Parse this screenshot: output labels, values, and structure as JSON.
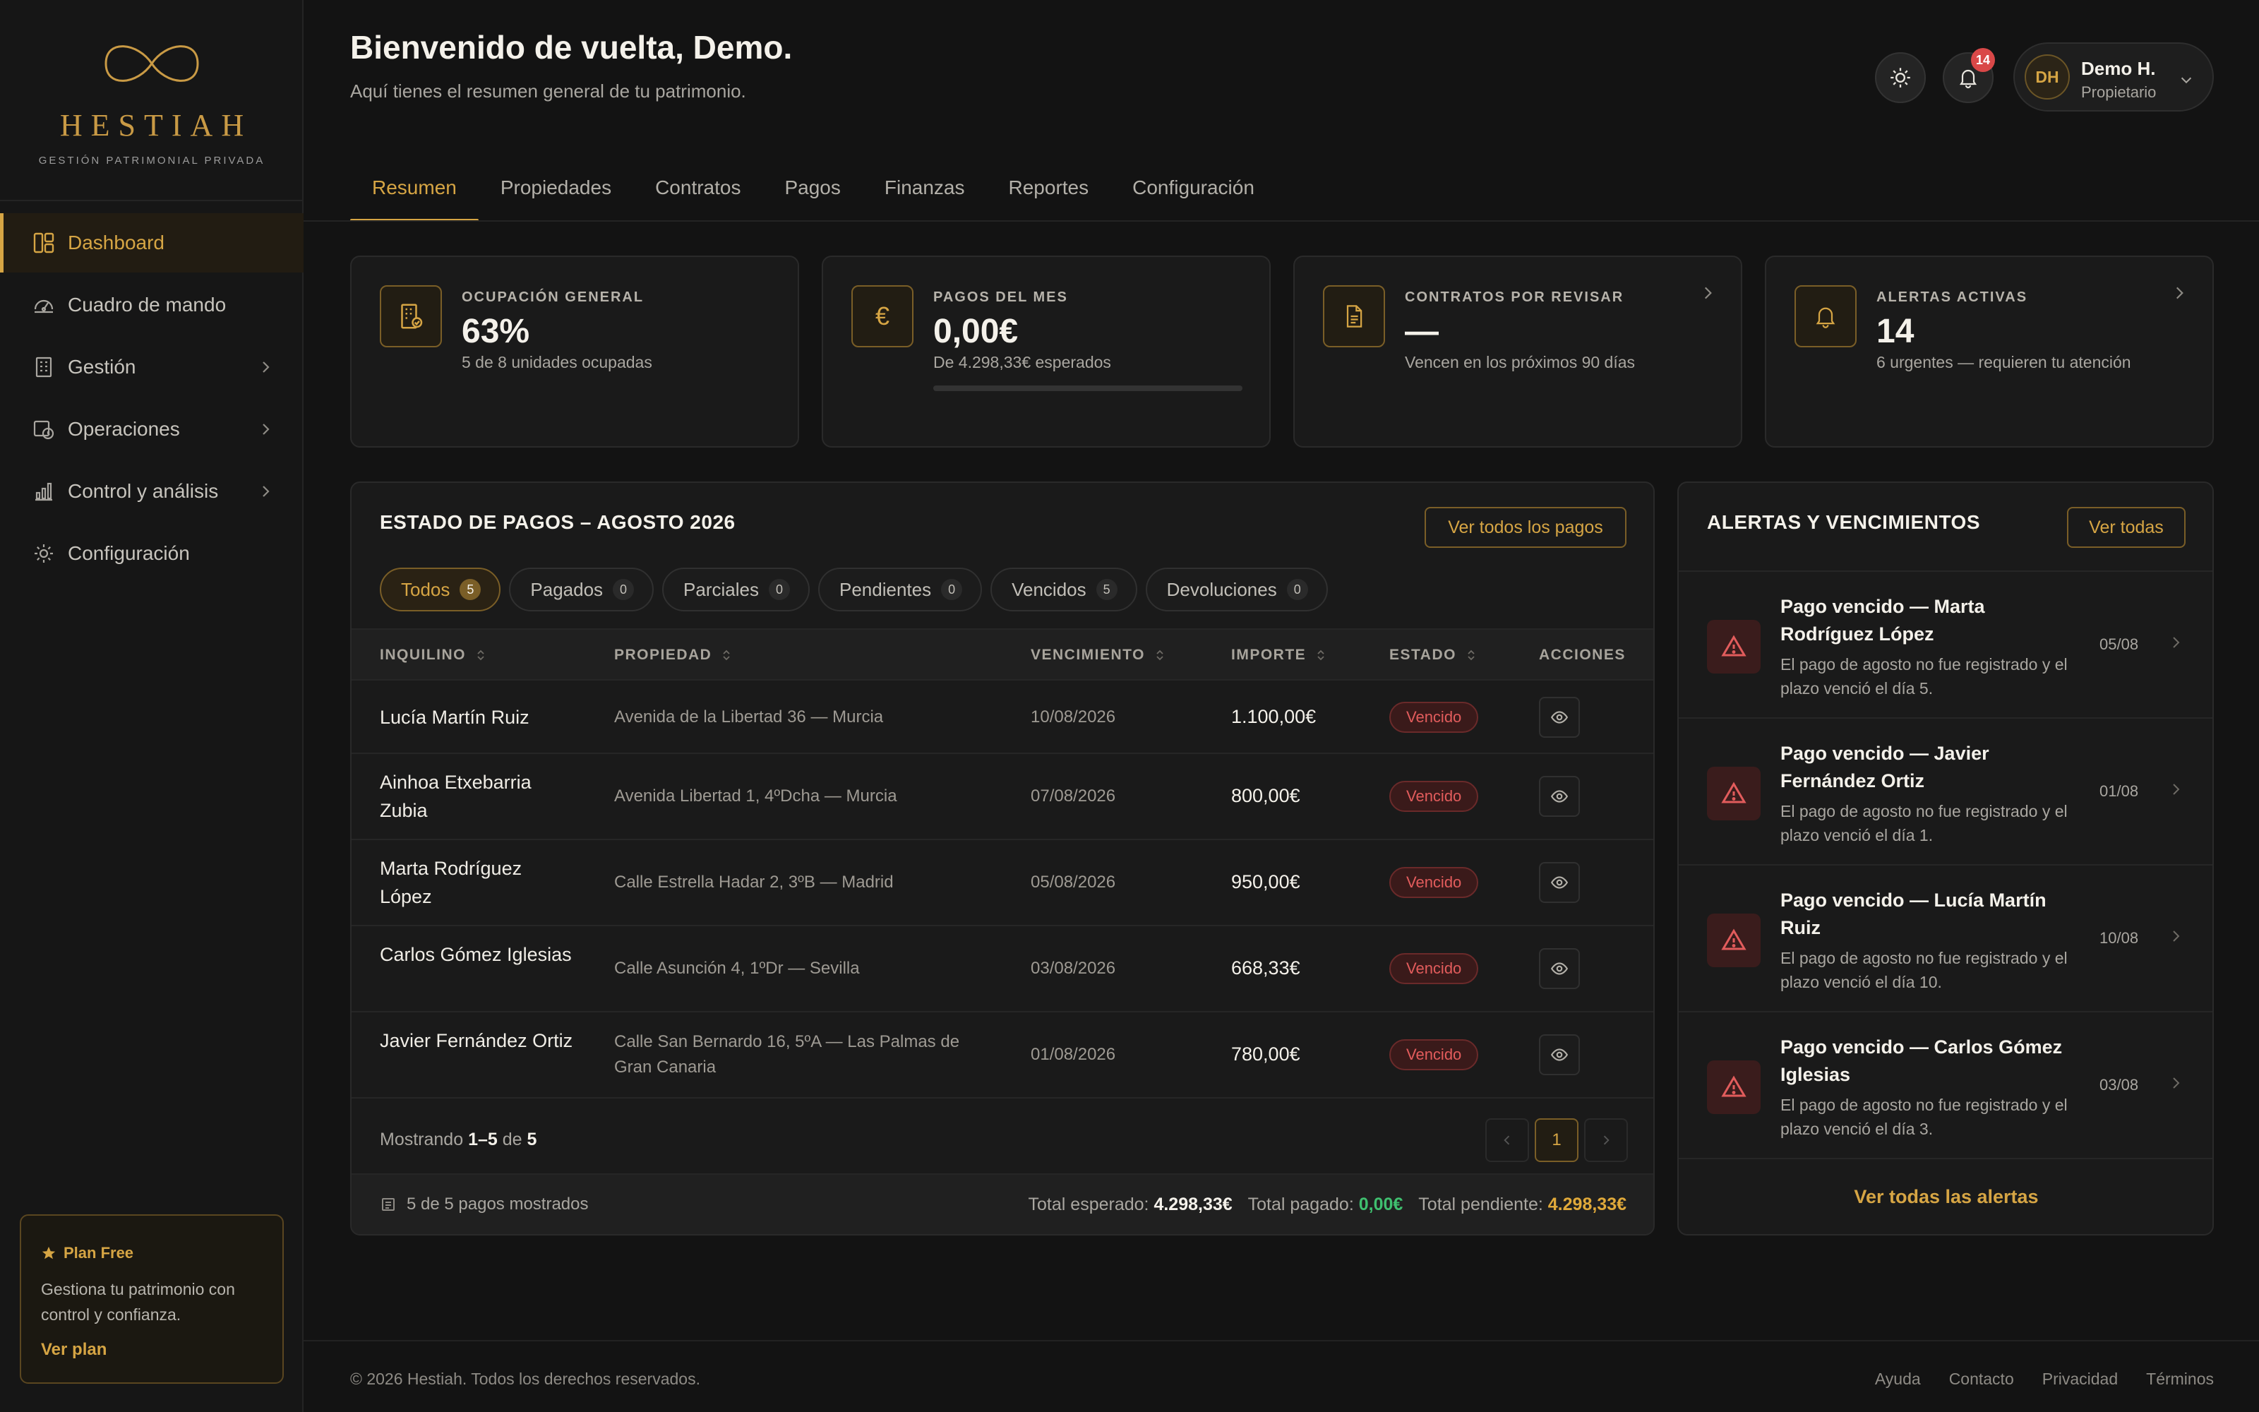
{
  "brand": {
    "name": "HESTIAH",
    "tagline": "GESTIÓN PATRIMONIAL PRIVADA"
  },
  "sidebar": {
    "items": [
      {
        "label": "Dashboard",
        "icon": "dashboard-icon",
        "active": true
      },
      {
        "label": "Cuadro de mando",
        "icon": "gauge-icon"
      },
      {
        "label": "Gestión",
        "icon": "building-icon",
        "has_children": true
      },
      {
        "label": "Operaciones",
        "icon": "operations-icon",
        "has_children": true
      },
      {
        "label": "Control y análisis",
        "icon": "chart-icon",
        "has_children": true
      },
      {
        "label": "Configuración",
        "icon": "gear-icon"
      }
    ],
    "plan": {
      "title": "Plan Free",
      "description": "Gestiona tu patrimonio con control y confianza.",
      "link": "Ver plan"
    }
  },
  "header": {
    "title": "Bienvenido de vuelta, Demo.",
    "subtitle": "Aquí tienes el resumen general de tu patrimonio.",
    "notifications_count": "14",
    "user": {
      "initials": "DH",
      "name": "Demo H.",
      "role": "Propietario"
    }
  },
  "tabs": [
    {
      "label": "Resumen",
      "active": true
    },
    {
      "label": "Propiedades"
    },
    {
      "label": "Contratos"
    },
    {
      "label": "Pagos"
    },
    {
      "label": "Finanzas"
    },
    {
      "label": "Reportes"
    },
    {
      "label": "Configuración"
    }
  ],
  "kpis": [
    {
      "label": "OCUPACIÓN GENERAL",
      "value": "63%",
      "sub": "5 de 8 unidades ocupadas",
      "icon": "building-check-icon"
    },
    {
      "label": "PAGOS DEL MES",
      "value": "0,00€",
      "sub": "De 4.298,33€ esperados",
      "icon": "euro-icon",
      "progress": 0
    },
    {
      "label": "CONTRATOS POR REVISAR",
      "value": "—",
      "sub": "Vencen en los próximos 90 días",
      "icon": "document-icon"
    },
    {
      "label": "ALERTAS ACTIVAS",
      "value": "14",
      "sub": "6 urgentes — requieren tu atención",
      "icon": "bell-icon"
    }
  ],
  "payments": {
    "title": "ESTADO DE PAGOS – AGOSTO 2026",
    "view_all": "Ver todos los pagos",
    "filters": [
      {
        "label": "Todos",
        "count": "5",
        "active": true
      },
      {
        "label": "Pagados",
        "count": "0"
      },
      {
        "label": "Parciales",
        "count": "0"
      },
      {
        "label": "Pendientes",
        "count": "0"
      },
      {
        "label": "Vencidos",
        "count": "5"
      },
      {
        "label": "Devoluciones",
        "count": "0"
      }
    ],
    "columns": [
      "INQUILINO",
      "PROPIEDAD",
      "VENCIMIENTO",
      "IMPORTE",
      "ESTADO",
      "ACCIONES"
    ],
    "rows": [
      {
        "tenant": "Lucía Martín Ruiz",
        "property": "Avenida de la Libertad 36 — Murcia",
        "due": "10/08/2026",
        "amount": "1.100,00€",
        "status": "Vencido"
      },
      {
        "tenant": "Ainhoa Etxebarria Zubia",
        "property": "Avenida Libertad 1, 4ºDcha — Murcia",
        "due": "07/08/2026",
        "amount": "800,00€",
        "status": "Vencido"
      },
      {
        "tenant": "Marta Rodríguez López",
        "property": "Calle Estrella Hadar 2, 3ºB — Madrid",
        "due": "05/08/2026",
        "amount": "950,00€",
        "status": "Vencido"
      },
      {
        "tenant": "Carlos Gómez Iglesias",
        "property": "Calle Asunción 4, 1ºDr — Sevilla",
        "due": "03/08/2026",
        "amount": "668,33€",
        "status": "Vencido"
      },
      {
        "tenant": "Javier Fernández Ortiz",
        "property": "Calle San Bernardo 16, 5ºA — Las Palmas de Gran Canaria",
        "due": "01/08/2026",
        "amount": "780,00€",
        "status": "Vencido"
      }
    ],
    "pager": {
      "prefix": "Mostrando",
      "range": "1–5",
      "of": "de",
      "total": "5",
      "page": "1"
    },
    "footer": {
      "shown": "5 de 5 pagos mostrados",
      "expected_label": "Total esperado:",
      "expected": "4.298,33€",
      "paid_label": "Total pagado:",
      "paid": "0,00€",
      "pending_label": "Total pendiente:",
      "pending": "4.298,33€"
    }
  },
  "alerts": {
    "title": "ALERTAS Y VENCIMIENTOS",
    "view_all": "Ver todas",
    "items": [
      {
        "title": "Pago vencido — Marta Rodríguez López",
        "desc": "El pago de agosto no fue registrado y el plazo venció el día 5.",
        "date": "05/08"
      },
      {
        "title": "Pago vencido — Javier Fernández Ortiz",
        "desc": "El pago de agosto no fue registrado y el plazo venció el día 1.",
        "date": "01/08"
      },
      {
        "title": "Pago vencido — Lucía Martín Ruiz",
        "desc": "El pago de agosto no fue registrado y el plazo venció el día 10.",
        "date": "10/08"
      },
      {
        "title": "Pago vencido — Carlos Gómez Iglesias",
        "desc": "El pago de agosto no fue registrado y el plazo venció el día 3.",
        "date": "03/08"
      }
    ],
    "all_link": "Ver todas las alertas"
  },
  "footer": {
    "copyright": "© 2026 Hestiah. Todos los derechos reservados.",
    "links": [
      "Ayuda",
      "Contacto",
      "Privacidad",
      "Términos"
    ]
  },
  "colors": {
    "accent": "#d6a544",
    "danger": "#e25c5c",
    "success": "#3fbf6f",
    "background": "#131313"
  }
}
